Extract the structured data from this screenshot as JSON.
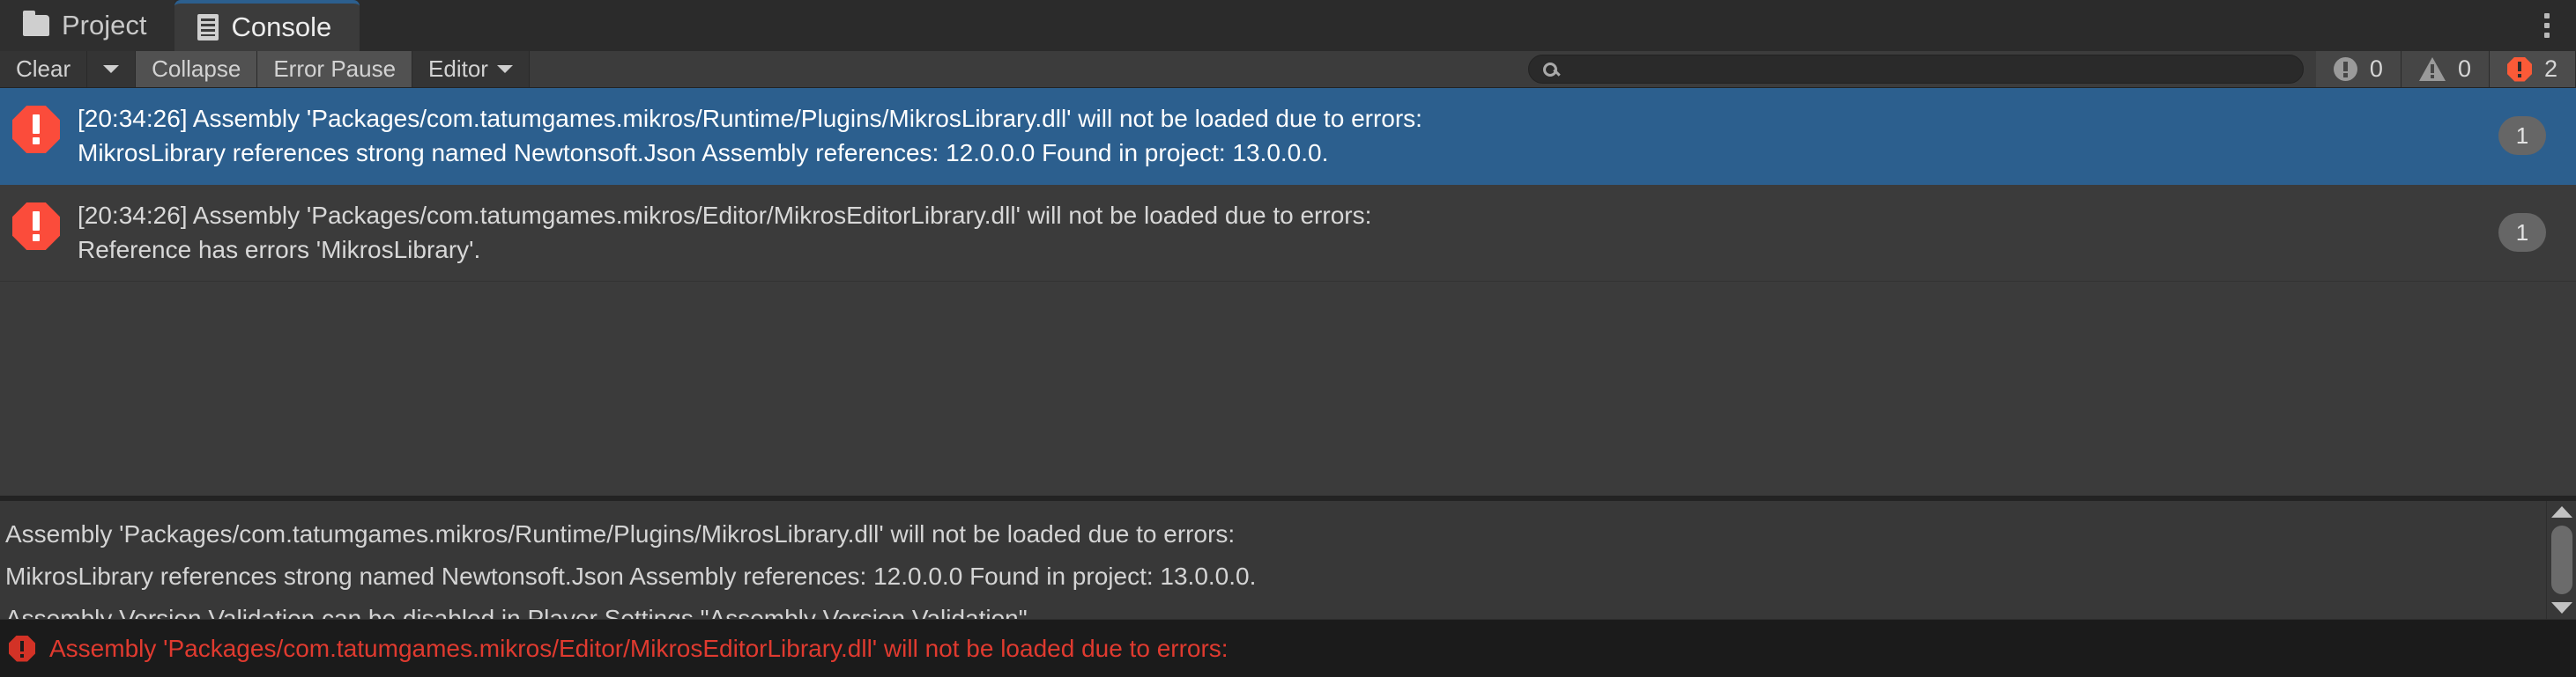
{
  "window": {
    "tabs": [
      {
        "label": "Project",
        "icon": "folder-icon",
        "active": false
      },
      {
        "label": "Console",
        "icon": "console-icon",
        "active": true
      }
    ],
    "menu_icon": "kebab-menu-icon"
  },
  "toolbar": {
    "clear_label": "Clear",
    "clear_dropdown_icon": "chevron-down-icon",
    "collapse_label": "Collapse",
    "error_pause_label": "Error Pause",
    "editor_label": "Editor",
    "editor_dropdown_icon": "chevron-down-icon",
    "search_placeholder": "",
    "search_value": "",
    "search_icon": "search-icon",
    "counters": {
      "info_icon": "info-circle-icon",
      "info_count": "0",
      "warning_icon": "warning-triangle-icon",
      "warning_count": "0",
      "error_icon": "error-octagon-icon",
      "error_count": "2"
    }
  },
  "log_entries": [
    {
      "icon": "error-octagon-icon",
      "line1": "[20:34:26] Assembly 'Packages/com.tatumgames.mikros/Runtime/Plugins/MikrosLibrary.dll' will not be loaded due to errors:",
      "line2": "MikrosLibrary references strong named Newtonsoft.Json Assembly references: 12.0.0.0 Found in project: 13.0.0.0.",
      "count": "1",
      "selected": true
    },
    {
      "icon": "error-octagon-icon",
      "line1": "[20:34:26] Assembly 'Packages/com.tatumgames.mikros/Editor/MikrosEditorLibrary.dll' will not be loaded due to errors:",
      "line2": "Reference has errors 'MikrosLibrary'.",
      "count": "1",
      "selected": false
    }
  ],
  "detail": {
    "lines": [
      "Assembly 'Packages/com.tatumgames.mikros/Runtime/Plugins/MikrosLibrary.dll' will not be loaded due to errors:",
      "MikrosLibrary references strong named Newtonsoft.Json Assembly references: 12.0.0.0 Found in project: 13.0.0.0.",
      "Assembly Version Validation can be disabled in Player Settings \"Assembly Version Validation\""
    ],
    "scroll_up_icon": "scroll-up-arrow-icon",
    "scroll_down_icon": "scroll-down-arrow-icon"
  },
  "status_bar": {
    "icon": "error-octagon-icon",
    "text": "Assembly 'Packages/com.tatumgames.mikros/Editor/MikrosEditorLibrary.dll' will not be loaded due to errors:"
  },
  "colors": {
    "selection_blue": "#2c5f8e",
    "error_red": "#fb4c3b",
    "status_red": "#e03a2f",
    "panel_bg": "#383838",
    "toolbar_bg": "#3c3c3c"
  }
}
